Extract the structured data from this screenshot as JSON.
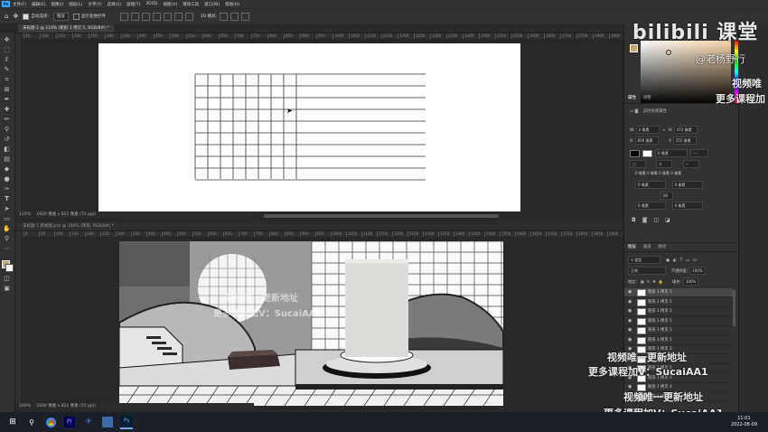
{
  "menubar": {
    "app_icon": "Ps",
    "items": [
      "文件(F)",
      "编辑(E)",
      "图像(I)",
      "图层(L)",
      "文字(Y)",
      "选择(S)",
      "滤镜(T)",
      "3D(D)",
      "视图(V)",
      "增效工具",
      "窗口(W)",
      "帮助(H)"
    ]
  },
  "options": {
    "auto_select_label": "自动选择:",
    "auto_select_value": "图层",
    "show_transform_label": "显示变换控件",
    "mode_3d": "3D 模式:"
  },
  "ime": {
    "label": "中"
  },
  "doc1": {
    "tab": "未标题-2 @ 110% (矩形 1 拷贝 5, RGB/8#) *",
    "ruler_ticks": [
      "50",
      "100",
      "150",
      "200",
      "250",
      "300",
      "350",
      "400",
      "450",
      "500",
      "550",
      "600",
      "650",
      "700",
      "750",
      "800",
      "850",
      "900",
      "950",
      "1000",
      "1050",
      "1100",
      "1150",
      "1200",
      "1250",
      "1300",
      "1350",
      "1400",
      "1450",
      "1500",
      "1550",
      "1600",
      "1650",
      "1700",
      "1750",
      "1800",
      "1850"
    ],
    "status_zoom": "110%",
    "status_info": "1920 像素 x 822 像素 (72 ppi)"
  },
  "doc2": {
    "tab": "未标题-1 新视图.psd @ 100% (矩形, RGB/8#) *",
    "ruler_ticks": [
      "0",
      "50",
      "100",
      "150",
      "200",
      "250",
      "300",
      "350",
      "400",
      "450",
      "500",
      "550",
      "600",
      "650",
      "700",
      "750",
      "800",
      "850",
      "900",
      "950",
      "1000",
      "1050",
      "1100",
      "1150",
      "1200",
      "1250",
      "1300",
      "1350",
      "1400",
      "1450",
      "1500",
      "1550",
      "1600",
      "1650",
      "1700",
      "1750",
      "1800",
      "1850",
      "1900"
    ],
    "status_zoom": "100%",
    "status_info": "1920 像素 x 822 像素 (72 ppi)"
  },
  "properties": {
    "tabs": [
      "属性",
      "调整"
    ],
    "section": "实时形状属性",
    "w": "2 像素",
    "h": "472 像素",
    "x": "850 像素",
    "y": "155 像素",
    "stroke": "0 像素",
    "radius_label": "0 像素 0 像素 0 像素 0 像素",
    "r1": "0 像素",
    "r2": "0 像素",
    "r3": "0 像素",
    "r4": "0 像素",
    "link": "00"
  },
  "layers": {
    "tabs": [
      "图层",
      "通道",
      "路径"
    ],
    "filter": "类型",
    "blend": "正常",
    "opacity_label": "不透明度:",
    "opacity": "100%",
    "lock_label": "锁定:",
    "fill_label": "填充:",
    "fill": "100%",
    "items": [
      "矩形 1 拷贝 5",
      "矩形 1 拷贝 5",
      "矩形 1 拷贝 5",
      "矩形 1 拷贝 5",
      "矩形 1 拷贝 5",
      "矩形 1 拷贝 5",
      "矩形 1 拷贝 5",
      "矩形 1 拷贝 5",
      "矩形 1 拷贝 5",
      "矩形 1 拷贝 5",
      "矩形 1 拷贝 4",
      "矩形 1 拷贝 4"
    ]
  },
  "watermarks": {
    "brand": "bilibili 课堂",
    "author": "@老杨野行",
    "side1": "视频唯",
    "side2": "更多课程加",
    "line1": "视频唯一更新地址",
    "line2": "更多课程加V：SucaiAA1",
    "center1": "视频唯一更新地址",
    "center2": "更多课程加V：SucaiAA1"
  },
  "taskbar": {
    "time": "11:01",
    "date": "2022-08-09",
    "apps": [
      "Pr",
      "Ps"
    ]
  },
  "colors": {
    "accent": "#31a8ff",
    "panel": "#323232",
    "bg": "#282828",
    "fg_swatch": "#c9a56a"
  }
}
